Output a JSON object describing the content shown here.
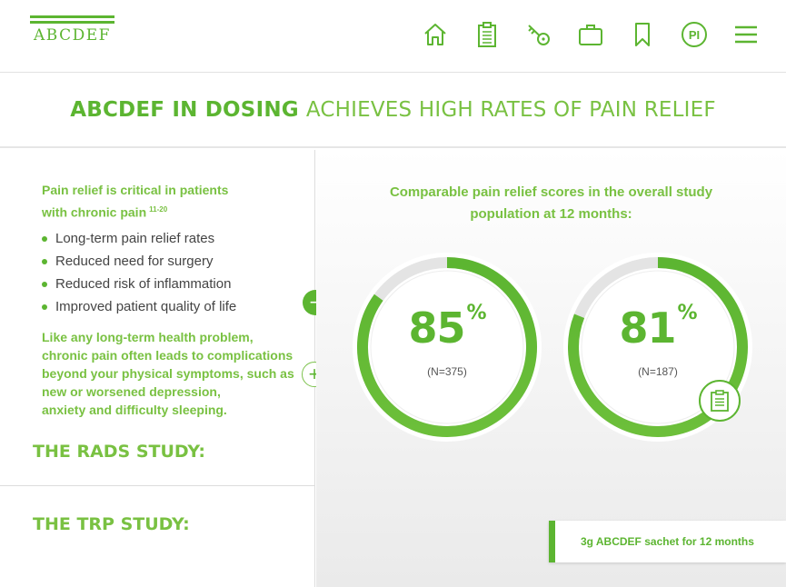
{
  "header": {
    "logo_text": "ABCDEF",
    "nav_icons": [
      "home-icon",
      "clipboard-icon",
      "key-icon",
      "briefcase-icon",
      "bookmark-icon",
      "pi-icon",
      "menu-icon"
    ],
    "pi_label": "PI"
  },
  "title": {
    "bold": "ABCDEF IN DOSING",
    "light": "ACHIEVES HIGH RATES OF PAIN RELIEF"
  },
  "left": {
    "lead_line1": "Pain relief is critical in patients",
    "lead_line2": "with chronic pain",
    "lead_ref": "11-20",
    "bullets": [
      "Long-term pain relief rates",
      "Reduced need for surgery",
      "Reduced risk of inflammation",
      "Improved patient quality of life"
    ],
    "para_lines": [
      "Like any long-term health problem,",
      "chronic pain often leads to complications",
      "beyond your physical symptoms, such as",
      "new or worsened depression,",
      "anxiety and difficulty sleeping."
    ],
    "study1": "THE RADS STUDY:",
    "study2": "THE TRP STUDY:",
    "minus_symbol": "−",
    "plus_symbol": "+"
  },
  "right": {
    "heading_line1": "Comparable pain relief scores in the overall study",
    "heading_line2": "population at 12 months:",
    "rings": [
      {
        "value": "85",
        "unit": "%",
        "n": "(N=375)",
        "fraction": 0.85
      },
      {
        "value": "81",
        "unit": "%",
        "n": "(N=187)",
        "fraction": 0.81
      }
    ],
    "sachet": "3g  ABCDEF sachet for 12 months"
  },
  "colors": {
    "accent": "#5cb531",
    "accent_light": "#79c142"
  }
}
